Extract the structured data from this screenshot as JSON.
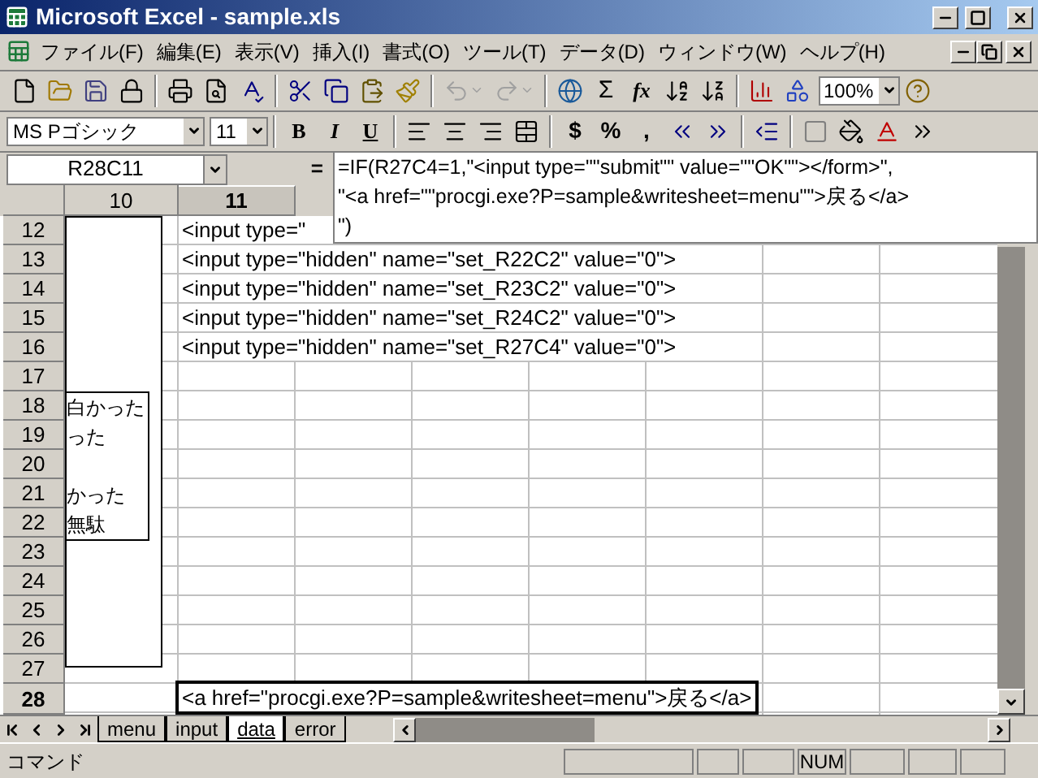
{
  "window": {
    "title": "Microsoft Excel - sample.xls"
  },
  "menu": [
    {
      "label": "ファイル(F)"
    },
    {
      "label": "編集(E)"
    },
    {
      "label": "表示(V)"
    },
    {
      "label": "挿入(I)"
    },
    {
      "label": "書式(O)"
    },
    {
      "label": "ツール(T)"
    },
    {
      "label": "データ(D)"
    },
    {
      "label": "ウィンドウ(W)"
    },
    {
      "label": "ヘルプ(H)"
    }
  ],
  "standard_toolbar": {
    "undo": {
      "disabled": true
    },
    "redo": {
      "disabled": true
    },
    "sum": "Σ",
    "function": "fx",
    "zoom": "100%"
  },
  "format_toolbar": {
    "font": "MS Pゴシック",
    "size": "11",
    "bold": "B",
    "italic": "I",
    "underline": "U",
    "currency": "$",
    "percent": "%",
    "comma": ","
  },
  "formula_bar": {
    "name_box": "R28C11",
    "equals": "=",
    "formula_lines": [
      "=IF(R27C4=1,\"<input type=\"\"submit\"\" value=\"\"OK\"\"></form>\",",
      "\"<a href=\"\"procgi.exe?P=sample&writesheet=menu\"\">戻る</a>",
      "\")"
    ]
  },
  "columns": [
    {
      "label": "10",
      "selected": false
    },
    {
      "label": "11",
      "selected": true
    }
  ],
  "rows": [
    {
      "label": "12",
      "selected": false,
      "column_11": "<input type=\""
    },
    {
      "label": "13",
      "selected": false,
      "column_11": "<input type=\"hidden\" name=\"set_R22C2\" value=\"0\">"
    },
    {
      "label": "14",
      "selected": false,
      "column_11": "<input type=\"hidden\" name=\"set_R23C2\" value=\"0\">"
    },
    {
      "label": "15",
      "selected": false,
      "column_11": "<input type=\"hidden\" name=\"set_R24C2\" value=\"0\">"
    },
    {
      "label": "16",
      "selected": false,
      "column_11": "<input type=\"hidden\" name=\"set_R27C4\" value=\"0\">"
    },
    {
      "label": "17",
      "selected": false
    },
    {
      "label": "18",
      "selected": false
    },
    {
      "label": "19",
      "selected": false
    },
    {
      "label": "20",
      "selected": false
    },
    {
      "label": "21",
      "selected": false
    },
    {
      "label": "22",
      "selected": false
    },
    {
      "label": "23",
      "selected": false
    },
    {
      "label": "24",
      "selected": false
    },
    {
      "label": "25",
      "selected": false
    },
    {
      "label": "26",
      "selected": false
    },
    {
      "label": "27",
      "selected": false
    },
    {
      "label": "28",
      "selected": true,
      "column_11": "<a href=\"procgi.exe?P=sample&writesheet=menu\">戻る</a>"
    }
  ],
  "text_box": {
    "lines": [
      {
        "kind": "text",
        "text": "白かった"
      },
      {
        "kind": "text",
        "text": "った"
      },
      {
        "kind": "blank"
      },
      {
        "kind": "text",
        "text": "かった"
      },
      {
        "kind": "text",
        "text": "無駄"
      }
    ]
  },
  "sheet_tabs": [
    {
      "label": "menu",
      "selected": false
    },
    {
      "label": "input",
      "selected": false
    },
    {
      "label": "data",
      "selected": true
    },
    {
      "label": "error",
      "selected": false
    }
  ],
  "status_bar": {
    "mode": "コマンド",
    "num": "NUM"
  }
}
